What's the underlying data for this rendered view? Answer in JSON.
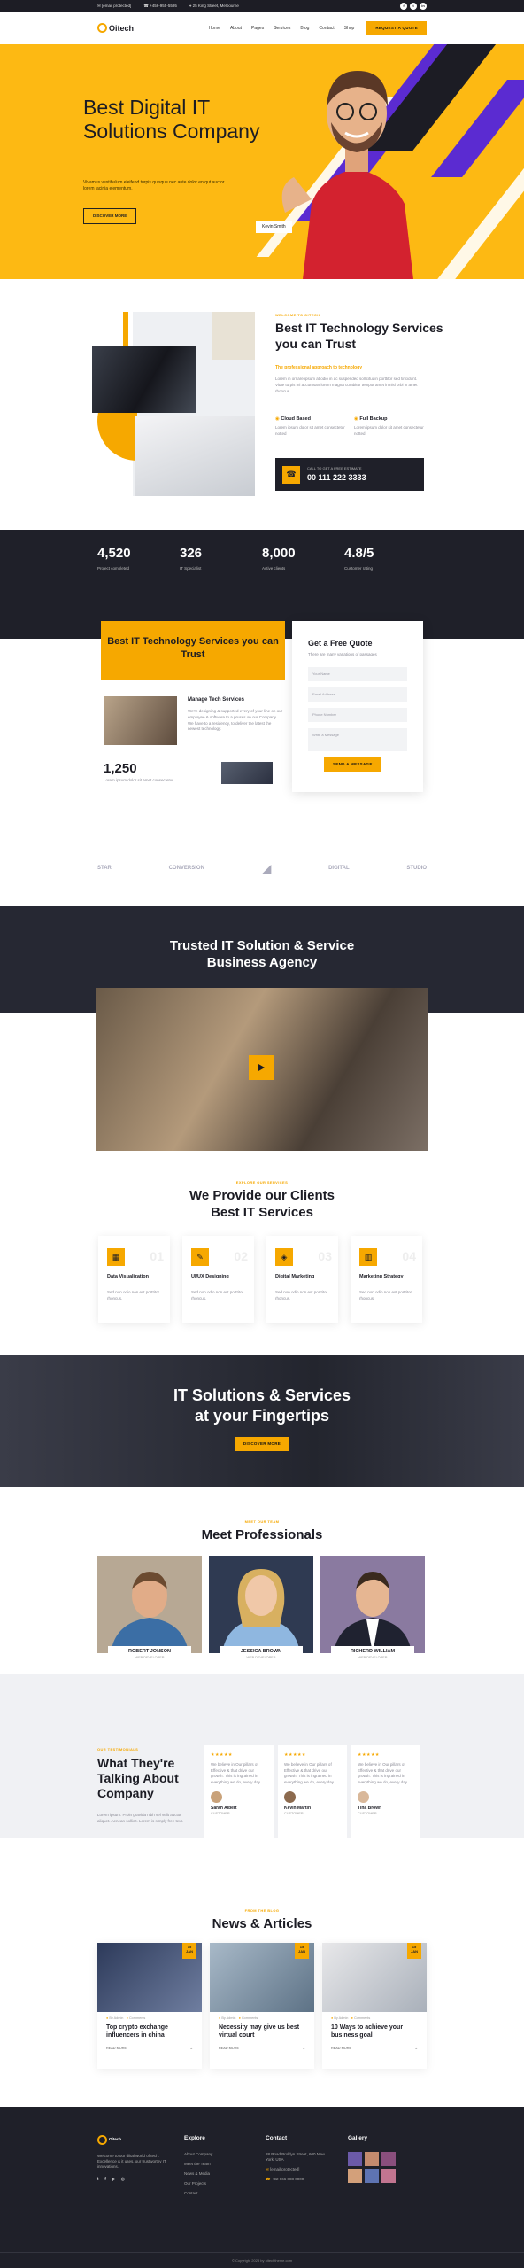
{
  "topbar": {
    "email": "[email protected]",
    "phone": "+456-955-5595",
    "address": "25 King Street, Melbourne",
    "social": [
      "f",
      "t",
      "in"
    ]
  },
  "nav": {
    "logo": "Oitech",
    "items": [
      "Home",
      "About",
      "Pages",
      "Services",
      "Blog",
      "Contact",
      "Shop"
    ],
    "cta": "REQUEST A QUOTE"
  },
  "hero": {
    "title": "Best Digital IT Solutions Company",
    "text": "Vivamus vestibulum eleifend turpis quisque nec ante dolor en qut auctor lorem lacinia elementum.",
    "button": "DISCOVER MORE",
    "person_name": "Kevin Smith"
  },
  "about": {
    "tag": "WELCOME TO OITECH",
    "title": "Best IT Technology Services you can Trust",
    "subtitle": "The professional approach to technology",
    "text": "Lorem in ornare ipsum at odio in ac suspended sollicitudin porttitor sed tincidunt. Vitae turpis mi accumsan lorem magna curabitur tempor amet in nisl orbi in amet rhoncus.",
    "features": [
      {
        "title": "Cloud Based",
        "text": "Lorem ipsum dolor sit amet consectetur notted"
      },
      {
        "title": "Full Backup",
        "text": "Lorem ipsum dolor sit amet consectetur notted"
      }
    ],
    "call_label": "CALL TO GET A FREE ESTIMATE",
    "call_number": "00 111 222 3333"
  },
  "stats": [
    {
      "value": "4,520",
      "label": "Project completed"
    },
    {
      "value": "326",
      "label": "IT Specialist"
    },
    {
      "value": "8,000",
      "label": "Active clients"
    },
    {
      "value": "4.8/5",
      "label": "Customer rating"
    }
  ],
  "quote": {
    "heading": "Best IT Technology Services you can Trust",
    "feature_title": "Manage Tech Services",
    "feature_text": "We're designing & supported every of your line on our employee & software to a pruses on our Company. We have to a residency, to deliver the latest the newest technology.",
    "count": "1,250",
    "count_label": "Lorem ipsum dolor sit amet consectetur",
    "form_title": "Get a Free Quote",
    "form_text": "There are many variations of passages",
    "fields": [
      "Your Name",
      "Email Address",
      "Phone Number",
      "Write a Message"
    ],
    "form_button": "SEND A MESSAGE"
  },
  "logos": [
    "STAR",
    "CONVERSION",
    "",
    "DIGITAL",
    "STUDIO"
  ],
  "video": {
    "title": "Trusted IT Solution & Service Business Agency"
  },
  "services": {
    "tag": "EXPLORE OUR SERVICES",
    "title": "We Provide our Clients Best IT Services",
    "items": [
      {
        "name": "Data Visualization",
        "num": "01",
        "text": "Sed non odio non est porttitor rhoncus."
      },
      {
        "name": "UI/UX Designing",
        "num": "02",
        "text": "Sed non odio non est porttitor rhoncus."
      },
      {
        "name": "Digital Marketing",
        "num": "03",
        "text": "Sed non odio non est porttitor rhoncus."
      },
      {
        "name": "Marketing Strategy",
        "num": "04",
        "text": "Sed non odio non est porttitor rhoncus."
      }
    ]
  },
  "cta": {
    "title": "IT Solutions & Services at your Fingertips",
    "button": "DISCOVER MORE"
  },
  "team": {
    "tag": "MEET OUR TEAM",
    "title": "Meet Professionals",
    "members": [
      {
        "name": "ROBERT JONSON",
        "role": "WEB DEVELOPER"
      },
      {
        "name": "JESSICA BROWN",
        "role": "WEB DEVELOPER"
      },
      {
        "name": "RICHERD WILLIAM",
        "role": "WEB DEVELOPER"
      }
    ]
  },
  "testimonials": {
    "tag": "OUR TESTIMONIALS",
    "title": "What They're Talking About Company",
    "text": "Lorem ipsum. Proin gravida nibh vel velit auctor aliquet. Aenean sollicit. Lorem is simply free text.",
    "items": [
      {
        "name": "Sarah Albert",
        "role": "CUSTOMER",
        "text": "We believe in Our pillars of Effective & that drive our growth. This is ingrained in everything we do, every day."
      },
      {
        "name": "Kevin Martin",
        "role": "CUSTOMER",
        "text": "We believe in Our pillars of Effective & that drive our growth. This is ingrained in everything we do, every day."
      },
      {
        "name": "Tina Brown",
        "role": "CUSTOMER",
        "text": "We believe in Our pillars of Effective & that drive our growth. This is ingrained in everything we do, every day."
      }
    ],
    "stars": "★★★★★"
  },
  "news": {
    "tag": "FROM THE BLOG",
    "title": "News & Articles",
    "items": [
      {
        "title": "Top crypto exchange influencers in china",
        "day": "15",
        "month": "JAN",
        "author": "By Admin",
        "comments": "Comments",
        "more": "READ MORE"
      },
      {
        "title": "Necessity may give us best virtual court",
        "day": "15",
        "month": "JAN",
        "author": "By Admin",
        "comments": "Comments",
        "more": "READ MORE"
      },
      {
        "title": "10 Ways to achieve your business goal",
        "day": "15",
        "month": "JAN",
        "author": "By Admin",
        "comments": "Comments",
        "more": "READ MORE"
      }
    ]
  },
  "footer": {
    "logo": "Oitech",
    "about": "Welcome to our diital world of tech. Excellence & it uses, our trustworthy IT innovations.",
    "explore_title": "Explore",
    "explore": [
      "About Company",
      "Meet the Team",
      "News & Media",
      "Our Projects",
      "Contact"
    ],
    "contact_title": "Contact",
    "contact": [
      "88 Road Broklyn Street, 600 New York, USA",
      "[email protected]",
      "+92 666 888 0000"
    ],
    "gallery_title": "Gallery",
    "copyright": "© Copyright 2023 by oitechtheme.com"
  }
}
